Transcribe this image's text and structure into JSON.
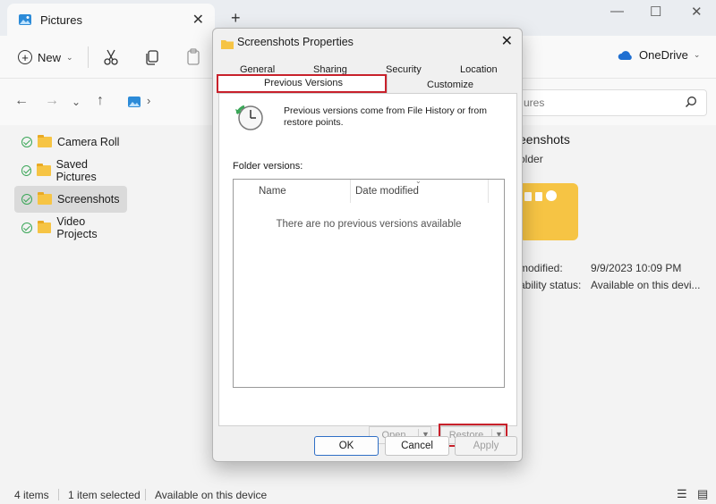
{
  "explorer": {
    "tab_title": "Pictures",
    "new_tab_symbol": "+",
    "toolbar": {
      "new_label": "New",
      "onedrive_label": "OneDrive"
    },
    "search_placeholder": "ures",
    "nav_items": [
      {
        "label": "Camera Roll",
        "selected": false
      },
      {
        "label": "Saved Pictures",
        "selected": false
      },
      {
        "label": "Screenshots",
        "selected": true
      },
      {
        "label": "Video Projects",
        "selected": false
      }
    ],
    "details": {
      "title": "eenshots",
      "subtitle": "older",
      "modified_label": "modified:",
      "modified_value": "9/9/2023 10:09 PM",
      "availability_label": "ability status:",
      "availability_value": "Available on this devi..."
    },
    "status": {
      "items": "4 items",
      "selected": "1 item selected",
      "availability": "Available on this device"
    }
  },
  "dialog": {
    "title": "Screenshots Properties",
    "tabs_row1": [
      "General",
      "Sharing",
      "Security",
      "Location"
    ],
    "tabs_row2": [
      "Previous Versions",
      "Customize"
    ],
    "active_tab": "Previous Versions",
    "intro_text": "Previous versions come from File History or from restore points.",
    "folder_versions_label": "Folder versions:",
    "columns": [
      "Name",
      "Date modified"
    ],
    "empty_message": "There are no previous versions available",
    "open_label": "Open",
    "restore_label": "Restore",
    "ok_label": "OK",
    "cancel_label": "Cancel",
    "apply_label": "Apply"
  },
  "colors": {
    "highlight": "#c8212b",
    "folder": "#f6c444",
    "accent": "#2f6fc6",
    "check": "#3aa657"
  }
}
